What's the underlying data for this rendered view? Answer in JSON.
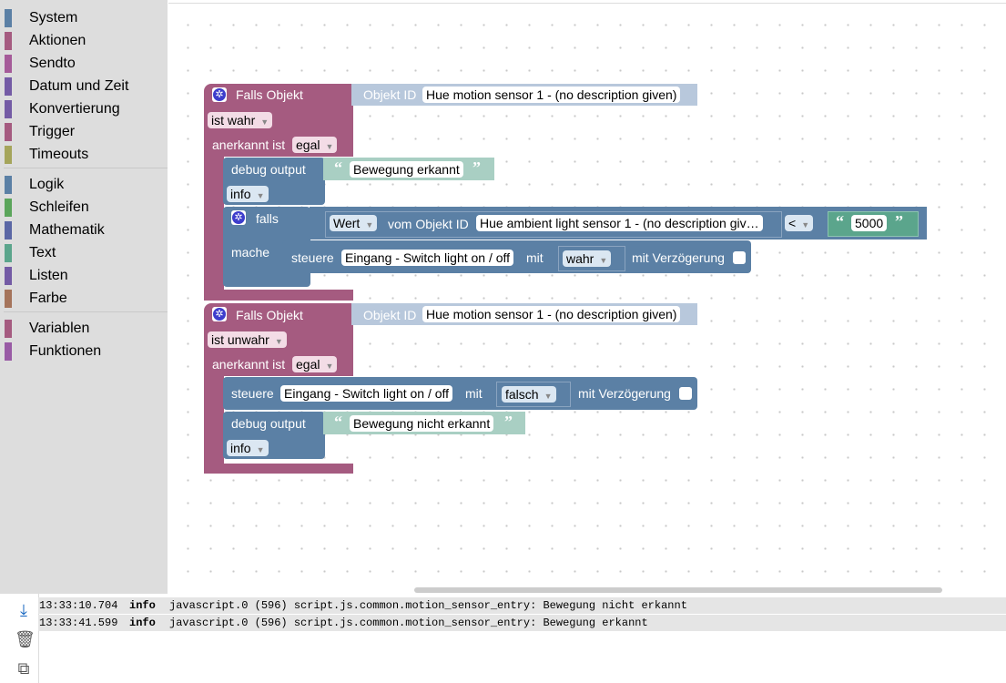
{
  "toolbox": {
    "categories": [
      {
        "label": "System",
        "color": "#5b80a5"
      },
      {
        "label": "Aktionen",
        "color": "#a55b80"
      },
      {
        "label": "Sendto",
        "color": "#a55b99"
      },
      {
        "label": "Datum und Zeit",
        "color": "#745ba5"
      },
      {
        "label": "Konvertierung",
        "color": "#745ba5"
      },
      {
        "label": "Trigger",
        "color": "#a55b80"
      },
      {
        "label": "Timeouts",
        "color": "#a5a55b"
      },
      {
        "label": "Logik",
        "color": "#5b80a5"
      },
      {
        "label": "Schleifen",
        "color": "#5ba55b"
      },
      {
        "label": "Mathematik",
        "color": "#5b67a5"
      },
      {
        "label": "Text",
        "color": "#5ba58c"
      },
      {
        "label": "Listen",
        "color": "#745ba5"
      },
      {
        "label": "Farbe",
        "color": "#a5745b"
      },
      {
        "label": "Variablen",
        "color": "#a55b80"
      },
      {
        "label": "Funktionen",
        "color": "#995ba5"
      }
    ]
  },
  "blocks": {
    "trigger1": {
      "header": "Falls Objekt",
      "objid_label": "Objekt ID",
      "objid_value": "Hue motion sensor 1 - (no description given)",
      "condition": "ist wahr",
      "ack_label": "anerkannt ist",
      "ack_value": "egal",
      "debug": {
        "label": "debug output",
        "text": "Bewegung erkannt",
        "level": "info"
      },
      "if": {
        "falls_label": "falls",
        "mache_label": "mache",
        "wert_label": "Wert",
        "vom_label": "vom Objekt ID",
        "obj": "Hue ambient light sensor 1 - (no description giv…",
        "op": "<",
        "number": "5000",
        "control": {
          "label": "steuere",
          "target": "Eingang - Switch light on / off",
          "mit": "mit",
          "value": "wahr",
          "delay": "mit Verzögerung"
        }
      }
    },
    "trigger2": {
      "header": "Falls Objekt",
      "objid_label": "Objekt ID",
      "objid_value": "Hue motion sensor 1 - (no description given)",
      "condition": "ist unwahr",
      "ack_label": "anerkannt ist",
      "ack_value": "egal",
      "control": {
        "label": "steuere",
        "target": "Eingang - Switch light on / off",
        "mit": "mit",
        "value": "falsch",
        "delay": "mit Verzögerung"
      },
      "debug": {
        "label": "debug output",
        "text": "Bewegung nicht erkannt",
        "level": "info"
      }
    }
  },
  "log": {
    "rows": [
      {
        "time": "13:33:10.704",
        "level": "info",
        "source": "javascript.0 (596) script.js.common.motion_sensor_entry: Bewegung nicht erkannt"
      },
      {
        "time": "13:33:41.599",
        "level": "info",
        "source": "javascript.0 (596) script.js.common.motion_sensor_entry: Bewegung erkannt"
      }
    ],
    "tools": [
      "download-icon",
      "delete-icon",
      "copy-icon"
    ]
  },
  "colors": {
    "trigger": "#a55b80",
    "logic": "#5b80a5",
    "text": "#5ba58c",
    "objid": "#b8c8dc"
  }
}
